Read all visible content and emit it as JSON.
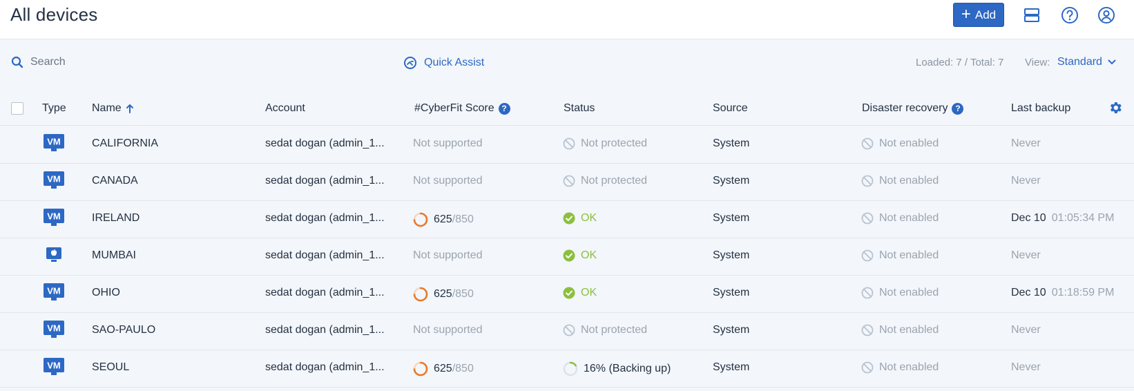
{
  "header": {
    "title": "All devices",
    "add_label": "Add",
    "icons": [
      "layout-icon",
      "help-icon",
      "user-icon"
    ]
  },
  "toolbar": {
    "search_placeholder": "Search",
    "quick_assist": "Quick Assist",
    "loaded": "Loaded: 7 / Total: 7",
    "view_label": "View:",
    "view_value": "Standard"
  },
  "columns": {
    "type": "Type",
    "name": "Name",
    "account": "Account",
    "cyberfit": "#CyberFit Score",
    "status": "Status",
    "source": "Source",
    "disaster_recovery": "Disaster recovery",
    "last_backup": "Last backup"
  },
  "rows": [
    {
      "type": "vm",
      "type_label": "VM",
      "name": "CALIFORNIA",
      "account": "sedat dogan (admin_1...",
      "score": null,
      "score_text": "Not supported",
      "score_total": "",
      "status_kind": "none",
      "status": "Not protected",
      "source": "System",
      "dr": "Not enabled",
      "backup_date": "Never",
      "backup_time": ""
    },
    {
      "type": "vm",
      "type_label": "VM",
      "name": "CANADA",
      "account": "sedat dogan (admin_1...",
      "score": null,
      "score_text": "Not supported",
      "score_total": "",
      "status_kind": "none",
      "status": "Not protected",
      "source": "System",
      "dr": "Not enabled",
      "backup_date": "Never",
      "backup_time": ""
    },
    {
      "type": "vm",
      "type_label": "VM",
      "name": "IRELAND",
      "account": "sedat dogan (admin_1...",
      "score": 625,
      "score_text": "625",
      "score_total": "/850",
      "status_kind": "ok",
      "status": "OK",
      "source": "System",
      "dr": "Not enabled",
      "backup_date": "Dec 10",
      "backup_time": "01:05:34 PM"
    },
    {
      "type": "mac",
      "type_label": "",
      "name": "MUMBAI",
      "account": "sedat dogan (admin_1...",
      "score": null,
      "score_text": "Not supported",
      "score_total": "",
      "status_kind": "ok",
      "status": "OK",
      "source": "System",
      "dr": "Not enabled",
      "backup_date": "Never",
      "backup_time": ""
    },
    {
      "type": "vm",
      "type_label": "VM",
      "name": "OHIO",
      "account": "sedat dogan (admin_1...",
      "score": 625,
      "score_text": "625",
      "score_total": "/850",
      "status_kind": "ok",
      "status": "OK",
      "source": "System",
      "dr": "Not enabled",
      "backup_date": "Dec 10",
      "backup_time": "01:18:59 PM"
    },
    {
      "type": "vm",
      "type_label": "VM",
      "name": "SAO-PAULO",
      "account": "sedat dogan (admin_1...",
      "score": null,
      "score_text": "Not supported",
      "score_total": "",
      "status_kind": "none",
      "status": "Not protected",
      "source": "System",
      "dr": "Not enabled",
      "backup_date": "Never",
      "backup_time": ""
    },
    {
      "type": "vm",
      "type_label": "VM",
      "name": "SEOUL",
      "account": "sedat dogan (admin_1...",
      "score": 625,
      "score_text": "625",
      "score_total": "/850",
      "status_kind": "progress",
      "progress": 0.16,
      "status": "16% (Backing up)",
      "source": "System",
      "dr": "Not enabled",
      "backup_date": "Never",
      "backup_time": ""
    }
  ],
  "colors": {
    "accent": "#2c68c4",
    "ok": "#8cbf3f",
    "score_ring": "#e8792a",
    "muted": "#9aa4b0"
  }
}
